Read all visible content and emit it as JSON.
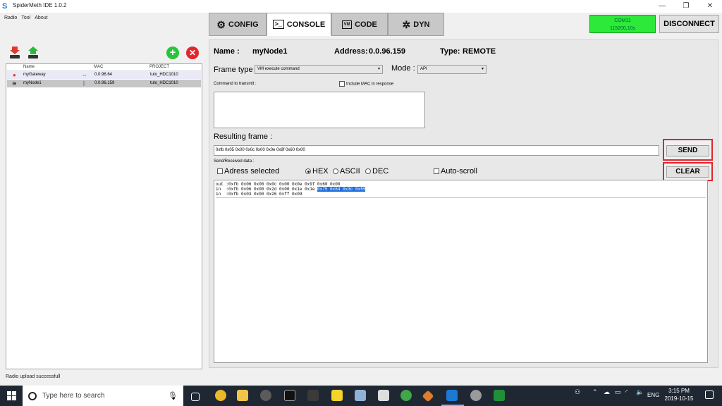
{
  "window": {
    "title": "SpiderMeth IDE 1.0.2",
    "minimize": "—",
    "restore": "❐",
    "close": "✕"
  },
  "menu": {
    "items": [
      "Radio",
      "Tool",
      "About"
    ]
  },
  "tabs": [
    {
      "label": "CONFIG",
      "icon": "gear-icon",
      "active": false
    },
    {
      "label": "CONSOLE",
      "icon": "terminal-icon",
      "active": true
    },
    {
      "label": "CODE",
      "icon": "vm-icon",
      "active": false
    },
    {
      "label": "DYN",
      "icon": "network-icon",
      "active": false
    }
  ],
  "connection": {
    "port": "COM11",
    "baud": "115200,10s",
    "color": "#2ce93a",
    "disconnect_label": "DISCONNECT"
  },
  "node_list": {
    "columns": [
      "Name",
      "MAC",
      "PROJECT"
    ],
    "rows": [
      {
        "icon": "location-pin-icon",
        "name": "myGateway",
        "link_icon": "usb-icon",
        "mac": "0.0.96.64",
        "project": "tuto_HDC1010",
        "selected": false
      },
      {
        "icon": "wifi-icon",
        "name": "myNode1",
        "link_icon": "bluetooth-icon",
        "mac": "0.0.96.159",
        "project": "tuto_HDC1010",
        "selected": true
      }
    ]
  },
  "node_header": {
    "name_label": "Name :",
    "name_value": "myNode1",
    "address_label": "Address:",
    "address_value": "0.0.96.159",
    "type_label": "Type:",
    "type_value": "REMOTE"
  },
  "frame": {
    "type_label": "Frame type",
    "type_value": "VM execute command",
    "mode_label": "Mode :",
    "mode_value": "API",
    "command_label": "Command to transmit :",
    "include_mac_label": "Include MAC in response",
    "command_value": "",
    "resulting_label": "Resulting frame :",
    "resulting_value": "0xfb 0x05 0x00 0x0c 0x00 0x0e 0x9f 0x60 0x00",
    "send_label": "SEND"
  },
  "received": {
    "label": "Send/Received data :",
    "address_selected_label": "Adress selected",
    "formats": [
      "HEX",
      "ASCII",
      "DEC"
    ],
    "selected_format": "HEX",
    "autoscroll_label": "Auto-scroll",
    "clear_label": "CLEAR",
    "lines": [
      {
        "text": "out :0xfb 0x06 0x00 0x0c 0x00 0x0e 0x9f 0x60 0x00",
        "highlight": ""
      },
      {
        "text": "in  :0xfb 0x06 0x00 0x2d 0x00 0x1e 0x1e ",
        "highlight": "0x75 0x64 0x3c 0x55"
      },
      {
        "text": "in  :0xfb 0x03 0x00 0x26 0xff 0x09",
        "highlight": ""
      }
    ]
  },
  "status": {
    "message": "Radio upload successfull"
  },
  "taskbar": {
    "search_placeholder": "Type here to search",
    "language": "ENG",
    "time": "3:15 PM",
    "date": "2019-10-15"
  }
}
